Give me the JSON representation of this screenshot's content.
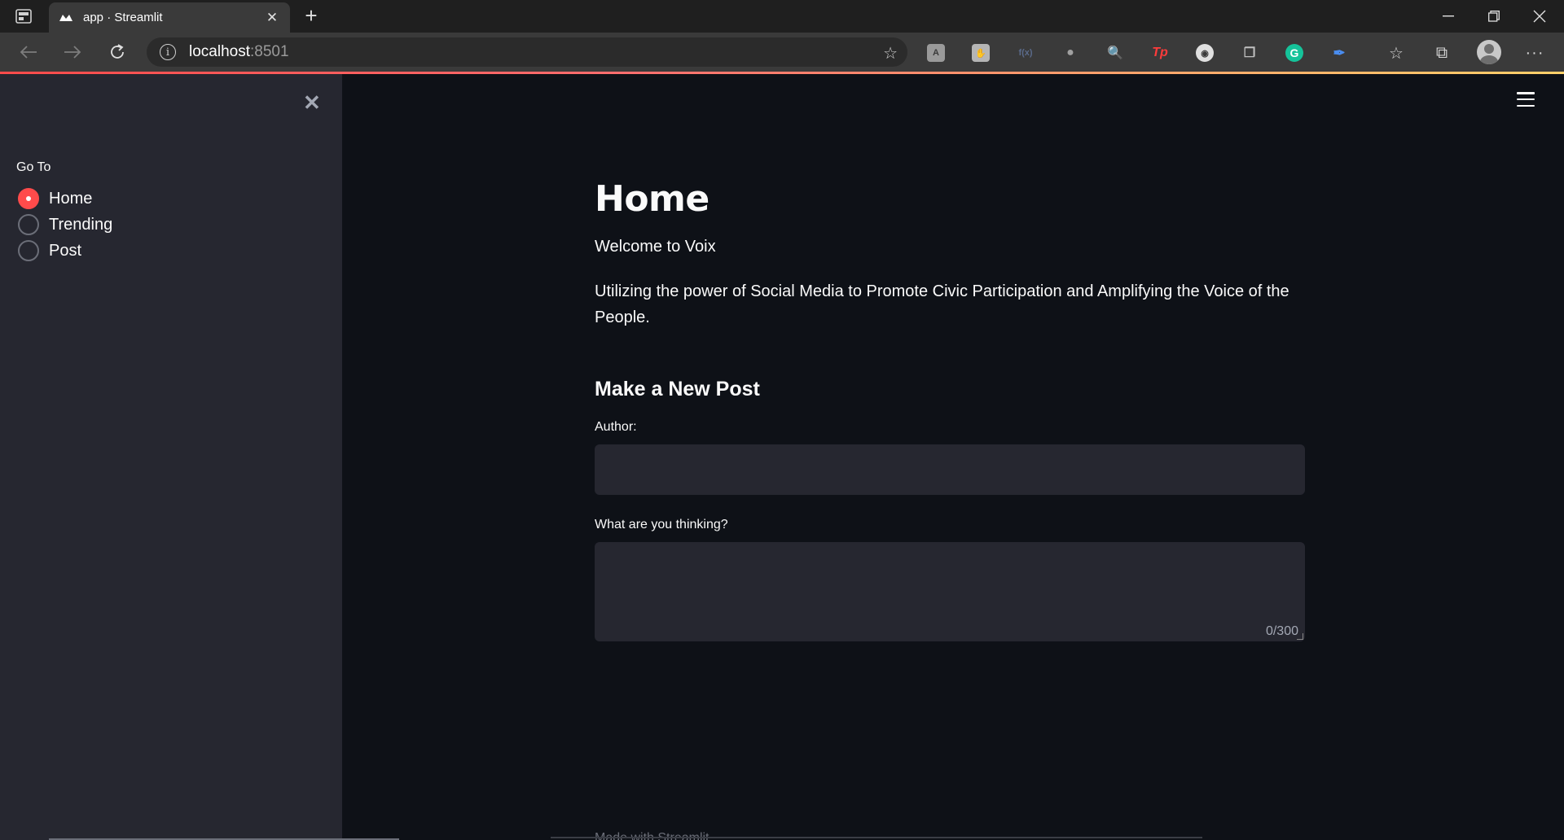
{
  "browser": {
    "tab_title": "app · Streamlit",
    "url_host": "localhost",
    "url_port": ":8501"
  },
  "sidebar": {
    "radio_label": "Go To",
    "options": [
      "Home",
      "Trending",
      "Post"
    ],
    "selected": "Home"
  },
  "main": {
    "title": "Home",
    "welcome": "Welcome to Voix",
    "tagline": "Utilizing the power of Social Media to Promote Civic Participation and Amplifying the Voice of the People.",
    "subheader": "Make a New Post",
    "author_label": "Author:",
    "author_value": "",
    "thinking_label": "What are you thinking?",
    "thinking_value": "",
    "char_counter": "0/300",
    "footer": "Made with Streamlit"
  },
  "colors": {
    "accent": "#ff4b4b",
    "background": "#0e1117",
    "sidebar_bg": "#262730"
  }
}
